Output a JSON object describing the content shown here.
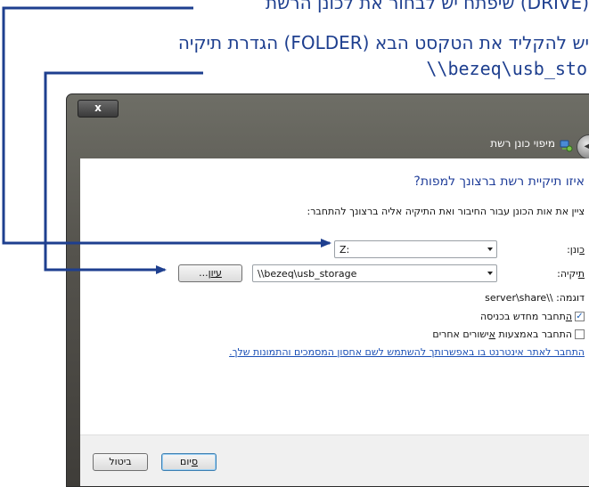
{
  "annotations": {
    "line1": "שיפתח יש לבחור את לכונן הרשת (DRIVE)",
    "line2": "הגדרת תיקיה (FOLDER) יש להקליד את הטקסט הבא",
    "line3": "\\\\bezeq\\usb_sto"
  },
  "colors": {
    "annotation": "#1e3f8f",
    "link": "#1a4fb5",
    "heading": "#1f3d99"
  },
  "window": {
    "close_label": "x",
    "title": "מיפוי כונן רשת",
    "back_icon": "back-arrow-icon",
    "network_icon": "network-drive-icon"
  },
  "dialog": {
    "heading": "איזו תיקיית רשת ברצונך למפות?",
    "instruction": "ציין את אות הכונן עבור החיבור ואת התיקיה אליה ברצונך להתחבר:",
    "drive_label_key": "כ",
    "drive_label_rest": "ונן:",
    "drive_value": "Z:",
    "folder_label_key": "ת",
    "folder_label_rest": "יקיה:",
    "folder_value": "\\\\bezeq\\usb_storage",
    "browse_key": "עיון",
    "browse_rest": "...",
    "example": "דוגמה: \\\\server\\share",
    "reconnect_key": "ה",
    "reconnect_rest": "תחבר מחדש בכניסה",
    "reconnect_checked": true,
    "other_creds_pre": "התחבר באמצעות ",
    "other_creds_key": "א",
    "other_creds_rest": "ישורים אחרים",
    "other_creds_checked": false,
    "link": "התחבר לאתר אינטרנט בו באפשרותך להשתמש לשם אחסון המסמכים והתמונות שלך."
  },
  "footer": {
    "finish_key": "ס",
    "finish_rest": "יום",
    "cancel": "ביטול"
  }
}
